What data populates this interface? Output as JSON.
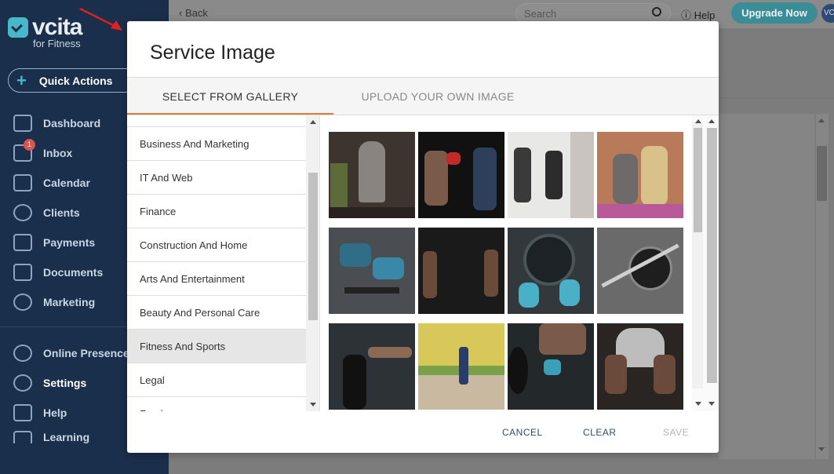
{
  "sidebar": {
    "logo_text": "vcita",
    "logo_sub": "for Fitness",
    "quick_actions_label": "Quick Actions",
    "items": [
      {
        "label": "Dashboard",
        "icon": "dashboard-icon"
      },
      {
        "label": "Inbox",
        "icon": "inbox-icon",
        "badge": "1"
      },
      {
        "label": "Calendar",
        "icon": "calendar-icon"
      },
      {
        "label": "Clients",
        "icon": "clients-icon"
      },
      {
        "label": "Payments",
        "icon": "payments-icon"
      },
      {
        "label": "Documents",
        "icon": "documents-icon"
      },
      {
        "label": "Marketing",
        "icon": "marketing-icon"
      }
    ],
    "items2": [
      {
        "label": "Online Presence",
        "icon": "globe-icon"
      },
      {
        "label": "Settings",
        "icon": "settings-icon"
      },
      {
        "label": "Help",
        "icon": "help-icon"
      },
      {
        "label": "Learning",
        "icon": "learning-icon"
      }
    ]
  },
  "header": {
    "back_label": "Back",
    "search_placeholder": "Search",
    "help_label": "Help",
    "upgrade_label": "Upgrade Now",
    "avatar_initials": "VC"
  },
  "modal": {
    "title": "Service Image",
    "tabs": [
      "SELECT FROM GALLERY",
      "UPLOAD YOUR OWN IMAGE"
    ],
    "categories": [
      "Business And Marketing",
      "IT And Web",
      "Finance",
      "Construction And Home",
      "Arts And Entertainment",
      "Beauty And Personal Care",
      "Fitness And Sports",
      "Legal",
      "Food"
    ],
    "selected_category": "Fitness And Sports",
    "buttons": {
      "cancel": "CANCEL",
      "clear": "CLEAR",
      "save": "SAVE"
    }
  },
  "colors": {
    "sidebar_bg": "#1a2f4c",
    "accent": "#48b8c9",
    "tab_underline": "#e07c3a",
    "button_text": "#2e4d73"
  }
}
